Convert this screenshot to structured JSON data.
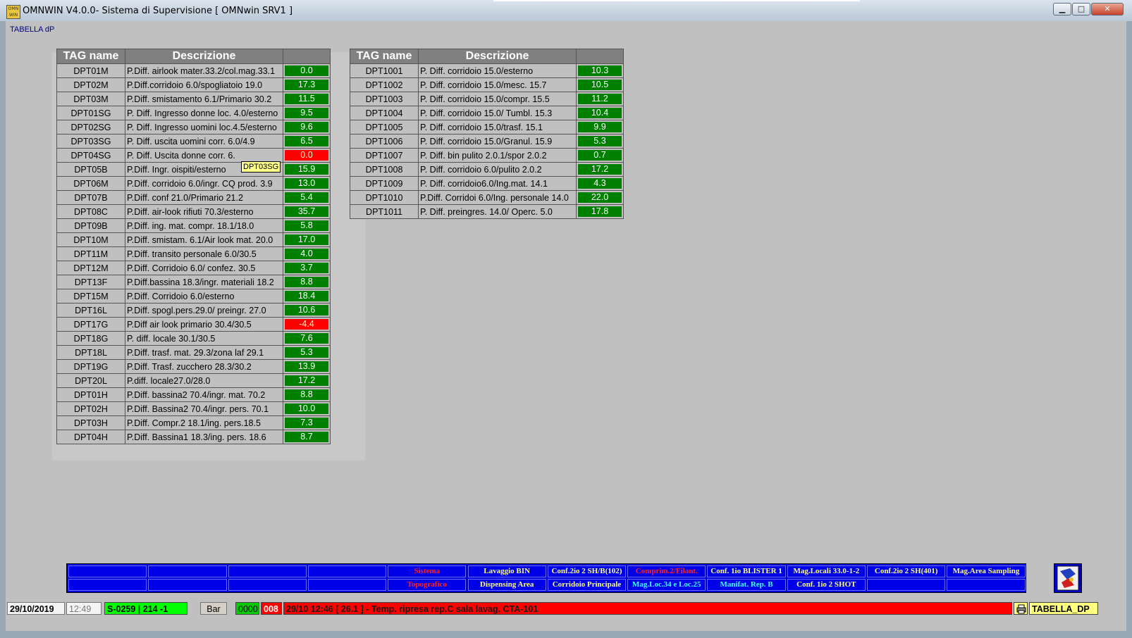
{
  "window": {
    "title": "OMNWIN V4.0.0- Sistema di Supervisione [ OMNwin SRV1 ]",
    "icon_text": "OMN WIN",
    "buttons": {
      "minimize": "▁",
      "maximize": "□",
      "close": "✕"
    }
  },
  "page": {
    "label": "TABELLA dP"
  },
  "table_left": {
    "headers": [
      "TAG name",
      "Descrizione",
      ""
    ],
    "rows": [
      {
        "tag": "DPT01M",
        "desc": "P.Diff. airlook mater.33.2/col.mag.33.1",
        "value": "0.0",
        "status": "ok"
      },
      {
        "tag": "DPT02M",
        "desc": "P.Diff.corridoio 6.0/spogliatoio 19.0",
        "value": "17.3",
        "status": "ok"
      },
      {
        "tag": "DPT03M",
        "desc": "P.Diff. smistamento 6.1/Primario 30.2",
        "value": "11.5",
        "status": "ok"
      },
      {
        "tag": "DPT01SG",
        "desc": "P. Diff. Ingresso donne loc. 4.0/esterno",
        "value": "9.5",
        "status": "ok"
      },
      {
        "tag": "DPT02SG",
        "desc": "P. Diff. Ingresso uomini loc.4.5/esterno",
        "value": "9.6",
        "status": "ok"
      },
      {
        "tag": "DPT03SG",
        "desc": "P. Diff. uscita uomini corr. 6.0/4.9",
        "value": "6.5",
        "status": "ok"
      },
      {
        "tag": "DPT04SG",
        "desc": "P. Diff. Uscita donne corr. 6.",
        "value": "0.0",
        "status": "alarm"
      },
      {
        "tag": "DPT05B",
        "desc": "P.Diff. Ingr. oispiti/esterno",
        "value": "15.9",
        "status": "ok"
      },
      {
        "tag": "DPT06M",
        "desc": "P.Diff. corridoio 6.0/ingr. CQ prod. 3.9",
        "value": "13.0",
        "status": "ok"
      },
      {
        "tag": "DPT07B",
        "desc": "P.Diff. conf 21.0/Primario 21.2",
        "value": "5.4",
        "status": "ok"
      },
      {
        "tag": "DPT08C",
        "desc": "P.Diff. air-look rifiuti 70.3/esterno",
        "value": "35.7",
        "status": "ok"
      },
      {
        "tag": "DPT09B",
        "desc": "P.Diff. ing. mat. compr. 18.1/18.0",
        "value": "5.8",
        "status": "ok"
      },
      {
        "tag": "DPT10M",
        "desc": "P.Diff. smistam. 6.1/Air look mat. 20.0",
        "value": "17.0",
        "status": "ok"
      },
      {
        "tag": "DPT11M",
        "desc": "P.Diff. transito personale 6.0/30.5",
        "value": "4.0",
        "status": "ok"
      },
      {
        "tag": "DPT12M",
        "desc": "P.Diff. Corridoio 6.0/ confez. 30.5",
        "value": "3.7",
        "status": "ok"
      },
      {
        "tag": "DPT13F",
        "desc": "P.Diff.bassina 18.3/ingr. materiali 18.2",
        "value": "8.8",
        "status": "ok"
      },
      {
        "tag": "DPT15M",
        "desc": "P.Diff. Corridoio 6.0/esterno",
        "value": "18.4",
        "status": "ok"
      },
      {
        "tag": "DPT16L",
        "desc": "P.Diff. spogl.pers.29.0/ preingr. 27.0",
        "value": "10.6",
        "status": "ok"
      },
      {
        "tag": "DPT17G",
        "desc": "P.Diff air look primario 30.4/30.5",
        "value": "-4.4",
        "status": "alarm"
      },
      {
        "tag": "DPT18G",
        "desc": "P. diff. locale 30.1/30.5",
        "value": "7.6",
        "status": "ok"
      },
      {
        "tag": "DPT18L",
        "desc": "P.Diff. trasf. mat. 29.3/zona laf 29.1",
        "value": "5.3",
        "status": "ok"
      },
      {
        "tag": "DPT19G",
        "desc": "P.Diff. Trasf. zucchero 28.3/30.2",
        "value": "13.9",
        "status": "ok"
      },
      {
        "tag": "DPT20L",
        "desc": "P.diff. locale27.0/28.0",
        "value": "17.2",
        "status": "ok"
      },
      {
        "tag": "DPT01H",
        "desc": "P.Diff. bassina2 70.4/ingr. mat. 70.2",
        "value": "8.8",
        "status": "ok"
      },
      {
        "tag": "DPT02H",
        "desc": "P.Diff. Bassina2 70.4/ingr. pers. 70.1",
        "value": "10.0",
        "status": "ok"
      },
      {
        "tag": "DPT03H",
        "desc": "P.Diff. Compr.2 18.1/ing. pers.18.5",
        "value": "7.3",
        "status": "ok"
      },
      {
        "tag": "DPT04H",
        "desc": "P.Diff. Bassina1 18.3/ing. pers. 18.6",
        "value": "8.7",
        "status": "ok"
      }
    ]
  },
  "table_right": {
    "headers": [
      "TAG name",
      "Descrizione",
      ""
    ],
    "rows": [
      {
        "tag": "DPT1001",
        "desc": "P. Diff. corridoio 15.0/esterno",
        "value": "10.3",
        "status": "ok"
      },
      {
        "tag": "DPT1002",
        "desc": "P. Diff. corridoio 15.0/mesc. 15.7",
        "value": "10.5",
        "status": "ok"
      },
      {
        "tag": "DPT1003",
        "desc": "P. Diff. corridoio 15.0/compr. 15.5",
        "value": "11.2",
        "status": "ok"
      },
      {
        "tag": "DPT1004",
        "desc": "P. Diff. corridoio 15.0/ Tumbl. 15.3",
        "value": "10.4",
        "status": "ok"
      },
      {
        "tag": "DPT1005",
        "desc": "P. Diff. corridoio 15.0/trasf. 15.1",
        "value": "9.9",
        "status": "ok"
      },
      {
        "tag": "DPT1006",
        "desc": "P. Diff. corridoio 15.0/Granul. 15.9",
        "value": "5.3",
        "status": "ok"
      },
      {
        "tag": "DPT1007",
        "desc": "P. Diff. bin pulito 2.0.1/spor 2.0.2",
        "value": "0.7",
        "status": "ok"
      },
      {
        "tag": "DPT1008",
        "desc": "P. Diff. corridoio 6.0/pulito 2.0.2",
        "value": "17.2",
        "status": "ok"
      },
      {
        "tag": "DPT1009",
        "desc": "P. Diff. corridoio6.0/Ing.mat. 14.1",
        "value": "4.3",
        "status": "ok"
      },
      {
        "tag": "DPT1010",
        "desc": "P.Diff. Corridoi 6.0/Ing. personale 14.0",
        "value": "22.0",
        "status": "ok"
      },
      {
        "tag": "DPT1011",
        "desc": "P. Diff. preingres. 14.0/ Operc. 5.0",
        "value": "17.8",
        "status": "ok"
      }
    ]
  },
  "tooltip": {
    "text": "DPT03SG"
  },
  "navbar": {
    "buttons": [
      {
        "label": "",
        "color": "#ffffff"
      },
      {
        "label": "",
        "color": "#ffffff"
      },
      {
        "label": "",
        "color": "#ffffff"
      },
      {
        "label": "",
        "color": "#ffffff"
      },
      {
        "label": "Sistema",
        "color": "#ff2020"
      },
      {
        "label": "Lavaggio BIN",
        "color": "#ffff80"
      },
      {
        "label": "Conf.2io 2 SH/B(102)",
        "color": "#ffff80"
      },
      {
        "label": "Comprim.2/Filant.",
        "color": "#ff2020"
      },
      {
        "label": "Conf. 1io BLISTER 1",
        "color": "#ffff80"
      },
      {
        "label": "Mag.Locali 33.0-1-2",
        "color": "#ffff80"
      },
      {
        "label": "Conf.2io 2 SH(401)",
        "color": "#ffff80"
      },
      {
        "label": "Mag.Area Sampling",
        "color": "#ffff80"
      },
      {
        "label": "",
        "color": "#ffffff"
      },
      {
        "label": "",
        "color": "#ffffff"
      },
      {
        "label": "",
        "color": "#ffffff"
      },
      {
        "label": "",
        "color": "#ffffff"
      },
      {
        "label": "Topografico",
        "color": "#ff2020"
      },
      {
        "label": "Dispensing Area",
        "color": "#ffff80"
      },
      {
        "label": "Corridoio Principale",
        "color": "#ffff80"
      },
      {
        "label": "Mag.Loc.34 e Loc.25",
        "color": "#40ffff"
      },
      {
        "label": "Manifat. Rep. B",
        "color": "#40ffff"
      },
      {
        "label": "Conf. 1io 2 SHOT",
        "color": "#ffff80"
      },
      {
        "label": "",
        "color": "#ffffff"
      },
      {
        "label": "",
        "color": "#ffffff"
      }
    ]
  },
  "statusbar": {
    "date": "29/10/2019",
    "time": "12:49",
    "server": "S-0259 | 214 -1",
    "bar_button": "Bar",
    "counter1": "0000",
    "counter2": "008",
    "alarm_text": "29/10 12:46  [ 26.1 ] - Temp. ripresa rep.C sala lavag. CTA-101",
    "printer_icon": "printer-icon",
    "page_name": "TABELLA_DP"
  },
  "colors": {
    "ok": "#008000",
    "alarm": "#ff0000",
    "navbar": "#0000d8",
    "status_green": "#00ff00"
  }
}
